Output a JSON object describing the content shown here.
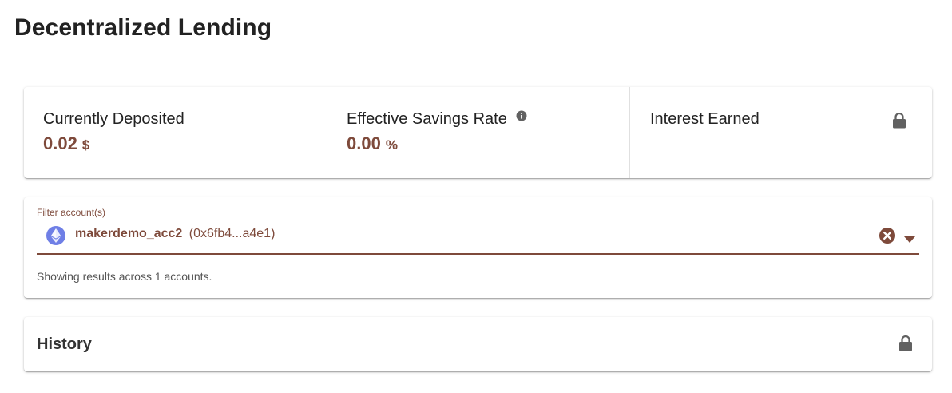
{
  "page": {
    "title": "Decentralized Lending"
  },
  "stats": {
    "deposited": {
      "label": "Currently Deposited",
      "value": "0.02",
      "unit": "$"
    },
    "savings_rate": {
      "label": "Effective Savings Rate",
      "value": "0.00",
      "unit": "%",
      "icon": "info-icon"
    },
    "interest": {
      "label": "Interest Earned",
      "icon": "lock-icon"
    }
  },
  "filter": {
    "label": "Filter account(s)",
    "selected_account": {
      "name": "makerdemo_acc2",
      "address": "(0x6fb4...a4e1)",
      "icon": "ethereum-icon"
    },
    "helper_text": "Showing results across 1 accounts."
  },
  "history": {
    "title": "History",
    "icon": "lock-icon"
  },
  "colors": {
    "accent": "#7e4a3b",
    "eth": "#6f7fe6",
    "lock": "#616161"
  }
}
